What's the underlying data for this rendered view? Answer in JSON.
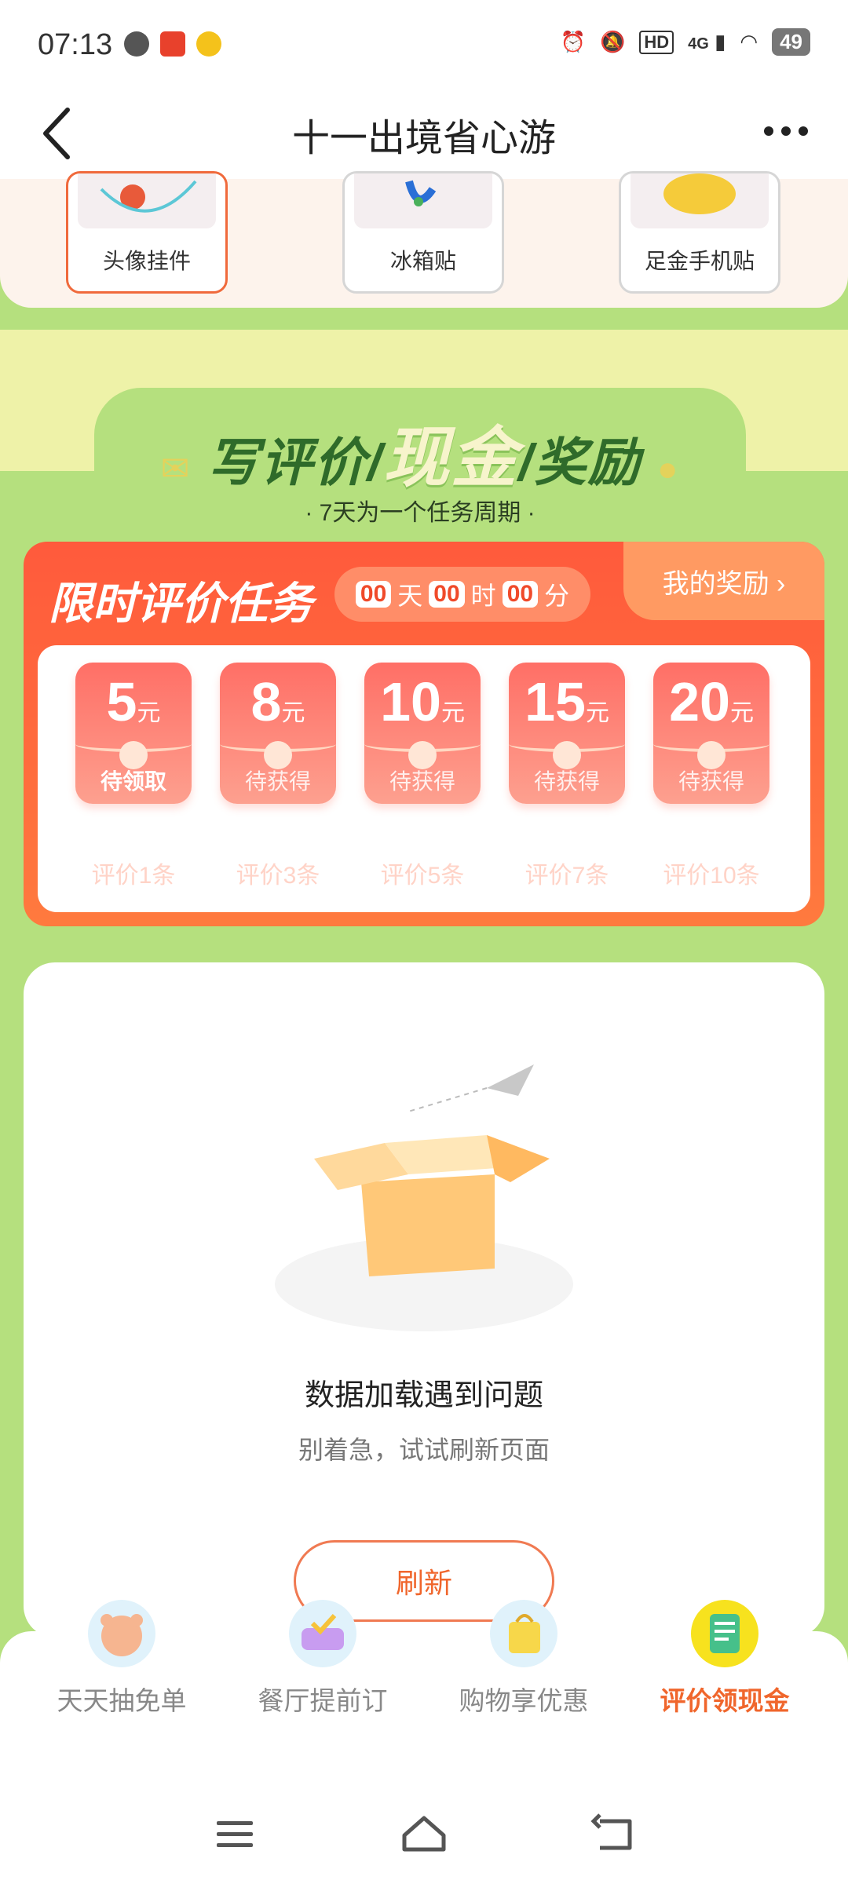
{
  "status_bar": {
    "time": "07:13",
    "network": "4G",
    "hd": "HD",
    "battery": "49"
  },
  "nav": {
    "title": "十一出境省心游"
  },
  "prizes": [
    {
      "label": "头像挂件",
      "selected": true
    },
    {
      "label": "冰箱贴",
      "selected": false
    },
    {
      "label": "足金手机贴",
      "selected": false
    }
  ],
  "banner": {
    "title_part1": "写评价",
    "title_highlight": "现金",
    "title_part2": "奖励",
    "subtitle": "· 7天为一个任务周期 ·"
  },
  "task": {
    "title": "限时评价任务",
    "countdown": {
      "days": "00",
      "days_unit": "天",
      "hours": "00",
      "hours_unit": "时",
      "minutes": "00",
      "minutes_unit": "分"
    },
    "my_reward_label": "我的奖励 ›",
    "rewards": [
      {
        "amount": "5",
        "unit": "元",
        "state": "待领取",
        "requirement": "评价1条",
        "active": true
      },
      {
        "amount": "8",
        "unit": "元",
        "state": "待获得",
        "requirement": "评价3条",
        "active": false
      },
      {
        "amount": "10",
        "unit": "元",
        "state": "待获得",
        "requirement": "评价5条",
        "active": false
      },
      {
        "amount": "15",
        "unit": "元",
        "state": "待获得",
        "requirement": "评价7条",
        "active": false
      },
      {
        "amount": "20",
        "unit": "元",
        "state": "待获得",
        "requirement": "评价10条",
        "active": false
      }
    ]
  },
  "empty_state": {
    "title": "数据加载遇到问题",
    "subtitle": "别着急，试试刷新页面",
    "button": "刷新"
  },
  "tabs": [
    {
      "label": "天天抽免单",
      "icon": "bear-icon",
      "active": false
    },
    {
      "label": "餐厅提前订",
      "icon": "sofa-icon",
      "active": false
    },
    {
      "label": "购物享优惠",
      "icon": "shopping-bag-icon",
      "active": false
    },
    {
      "label": "评价领现金",
      "icon": "notepad-icon",
      "active": true
    }
  ],
  "colors": {
    "accent_orange": "#f0662c",
    "task_red": "#ff5a3c",
    "bg_green": "#b5e07e",
    "banner_yellow": "#eef2a8"
  }
}
